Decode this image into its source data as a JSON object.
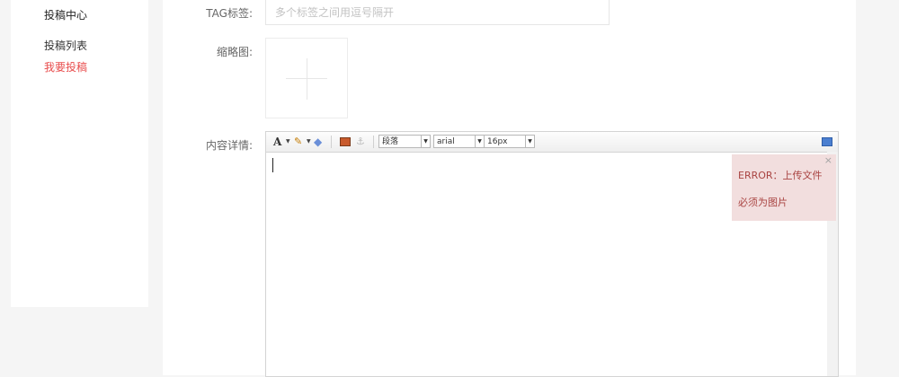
{
  "sidebar": {
    "title": "投稿中心",
    "items": [
      {
        "label": "投稿列表",
        "active": false
      },
      {
        "label": "我要投稿",
        "active": true
      }
    ],
    "active_color": "#e84c4c"
  },
  "form": {
    "tag": {
      "label": "TAG标签:",
      "placeholder": "多个标签之间用逗号隔开",
      "value": ""
    },
    "thumbnail": {
      "label": "缩略图:"
    },
    "content": {
      "label": "内容详情:"
    }
  },
  "editor": {
    "toolbar": {
      "paragraph_select": "段落",
      "font_select": "arial",
      "size_select": "16px",
      "font_color_icon": "A",
      "icons": [
        "font-color-icon",
        "highlight-brush-icon",
        "eraser-icon",
        "insert-image-icon",
        "anchor-icon",
        "fullscreen-icon"
      ]
    }
  },
  "error_tip": {
    "line1": "ERROR：上传文件",
    "line2": "必须为图片",
    "close": "×",
    "bg_color": "#f2dede",
    "text_color": "#a94442"
  }
}
